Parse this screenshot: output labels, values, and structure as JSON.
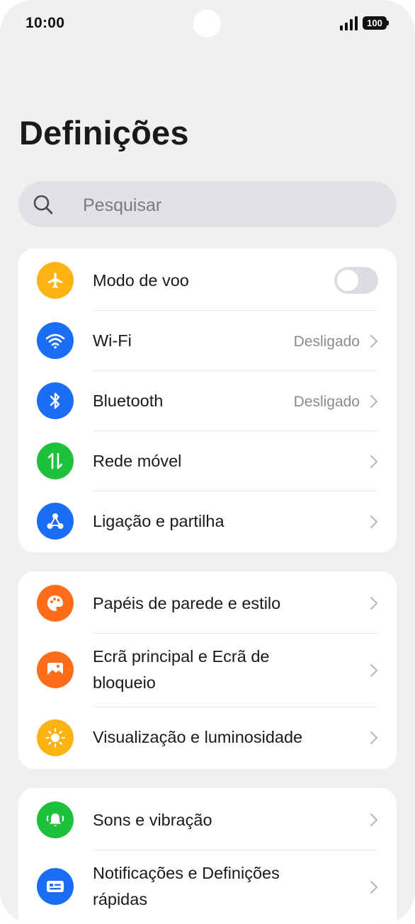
{
  "status_bar": {
    "time": "10:00",
    "battery": "100"
  },
  "title": "Definições",
  "search": {
    "placeholder": "Pesquisar"
  },
  "groups": [
    {
      "items": [
        {
          "label": "Modo de voo",
          "icon": "airplane-icon",
          "color": "#fbb313",
          "control": "toggle",
          "toggle_on": false
        },
        {
          "label": "Wi-Fi",
          "value": "Desligado",
          "icon": "wifi-icon",
          "color": "#1a6ef5"
        },
        {
          "label": "Bluetooth",
          "value": "Desligado",
          "icon": "bluetooth-icon",
          "color": "#1a6ef5"
        },
        {
          "label": "Rede móvel",
          "icon": "mobile-data-icon",
          "color": "#1ec03c"
        },
        {
          "label": "Ligação e partilha",
          "icon": "share-icon",
          "color": "#1a6ef5"
        }
      ]
    },
    {
      "items": [
        {
          "label": "Papéis de parede e estilo",
          "icon": "palette-icon",
          "color": "#ff6d1a"
        },
        {
          "label": "Ecrã principal e Ecrã de bloqueio",
          "icon": "wallpaper-icon",
          "color": "#ff6d1a"
        },
        {
          "label": "Visualização e luminosidade",
          "icon": "brightness-icon",
          "color": "#fbb313"
        }
      ]
    },
    {
      "items": [
        {
          "label": "Sons e vibração",
          "icon": "bell-icon",
          "color": "#1ec03c"
        },
        {
          "label": "Notificações e Definições rápidas",
          "icon": "notifications-icon",
          "color": "#1a6ef5"
        }
      ]
    }
  ]
}
